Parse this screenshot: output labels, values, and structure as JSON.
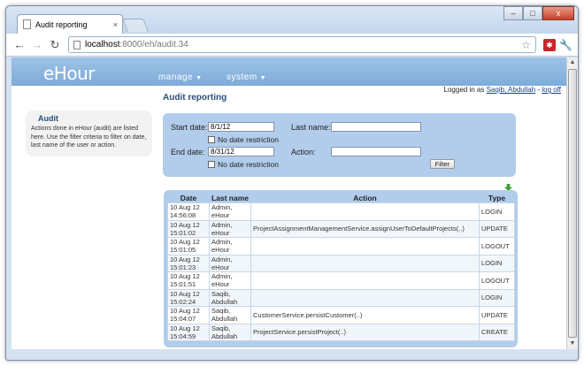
{
  "browser": {
    "tab_title": "Audit reporting",
    "tab_close": "×",
    "url_host": "localhost",
    "url_path": ":8000/eh/audit.34",
    "win_min": "–",
    "win_max": "□",
    "win_close": "x"
  },
  "app": {
    "logo": "eHour",
    "menu": [
      {
        "label": "manage"
      },
      {
        "label": "system"
      }
    ],
    "logged_in_prefix": "Logged in as",
    "user_name": "Saqib, Abdullah",
    "separator": "-",
    "logoff": "log off"
  },
  "page": {
    "title": "Audit reporting"
  },
  "sidebar": {
    "title": "Audit",
    "text": "Actions done in eHour (audit) are listed here. Use the filter criteria to filter on date, last name of the user or action."
  },
  "filter": {
    "start_label": "Start date:",
    "start_value": "8/1/12",
    "no_restriction_label": "No date restriction",
    "end_label": "End date:",
    "end_value": "8/31/12",
    "lastname_label": "Last name:",
    "lastname_value": "",
    "action_label": "Action:",
    "action_value": "",
    "button": "Filter"
  },
  "table": {
    "headers": [
      "Date",
      "Last name",
      "Action",
      "Type"
    ],
    "rows": [
      {
        "date": "10 Aug 12\n14:56:08",
        "name": "Admin,\neHour",
        "action": "",
        "type": "LOGIN"
      },
      {
        "date": "10 Aug 12\n15:01:02",
        "name": "Admin,\neHour",
        "action": "ProjectAssignmentManagementService.assignUserToDefaultProjects(..)",
        "type": "UPDATE"
      },
      {
        "date": "10 Aug 12\n15:01:05",
        "name": "Admin,\neHour",
        "action": "",
        "type": "LOGOUT"
      },
      {
        "date": "10 Aug 12\n15:01:23",
        "name": "Admin,\neHour",
        "action": "",
        "type": "LOGIN"
      },
      {
        "date": "10 Aug 12\n15:01:51",
        "name": "Admin,\neHour",
        "action": "",
        "type": "LOGOUT"
      },
      {
        "date": "10 Aug 12\n15:02:24",
        "name": "Saqib,\nAbdullah",
        "action": "",
        "type": "LOGIN"
      },
      {
        "date": "10 Aug 12\n15:04:07",
        "name": "Saqib,\nAbdullah",
        "action": "CustomerService.persistCustomer(..)",
        "type": "UPDATE"
      },
      {
        "date": "10 Aug 12\n15:04:59",
        "name": "Saqib,\nAbdullah",
        "action": "ProjectService.persistProject(..)",
        "type": "CREATE"
      }
    ]
  },
  "colors": {
    "header_blue": "#8db7e0",
    "panel_blue": "#b2cdeb",
    "title_blue": "#2c4f7a"
  }
}
